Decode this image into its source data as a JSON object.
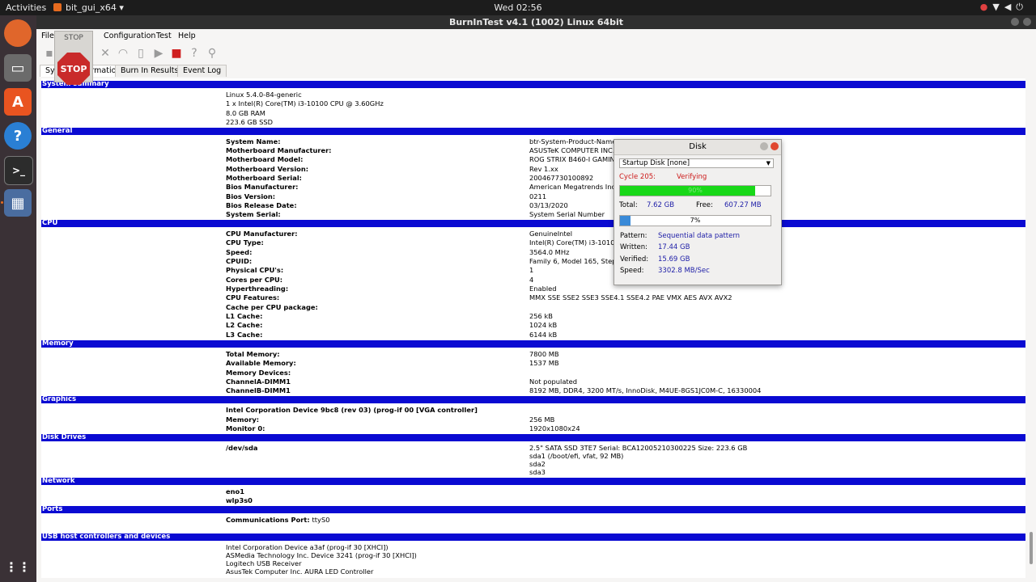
{
  "topbar": {
    "activities": "Activities",
    "app_name": "bit_gui_x64 ▾",
    "clock": "Wed 02:56",
    "tray_icons": [
      "camera-icon",
      "network-icon",
      "volume-icon",
      "power-icon"
    ]
  },
  "dock": {
    "items": [
      "firefox-icon",
      "files-icon",
      "software-icon",
      "help-icon",
      "terminal-icon",
      "burnintest-icon",
      "apps-grid-icon"
    ]
  },
  "window": {
    "title": "BurnInTest v4.1 (1002) Linux 64bit",
    "menu": [
      "File",
      "Configuration",
      "Test",
      "Help"
    ],
    "tabs": [
      "System Information",
      "Burn In Results",
      "Event Log"
    ],
    "stop_label": "STOP",
    "stop_sign": "STOP"
  },
  "sections": {
    "system_summary": {
      "title": "System summary",
      "lines": [
        "Linux 5.4.0-84-generic",
        "1 x Intel(R) Core(TM) i3-10100 CPU @ 3.60GHz",
        "8.0 GB RAM",
        "223.6 GB SSD"
      ]
    },
    "general": {
      "title": "General",
      "rows": [
        {
          "label": "System Name:",
          "value": "btr-System-Product-Name"
        },
        {
          "label": "Motherboard Manufacturer:",
          "value": "ASUSTeK COMPUTER INC."
        },
        {
          "label": "Motherboard Model:",
          "value": "ROG STRIX B460-I GAMING"
        },
        {
          "label": "Motherboard Version:",
          "value": "Rev 1.xx"
        },
        {
          "label": "Motherboard Serial:",
          "value": "200467730100892"
        },
        {
          "label": "Bios Manufacturer:",
          "value": "American Megatrends Inc."
        },
        {
          "label": "Bios Version:",
          "value": "0211"
        },
        {
          "label": "Bios Release Date:",
          "value": "03/13/2020"
        },
        {
          "label": "System Serial:",
          "value": "System Serial Number"
        }
      ]
    },
    "cpu": {
      "title": "CPU",
      "rows": [
        {
          "label": "CPU Manufacturer:",
          "value": "GenuineIntel"
        },
        {
          "label": "CPU Type:",
          "value": "Intel(R) Core(TM) i3-10100"
        },
        {
          "label": "Speed:",
          "value": "3564.0 MHz"
        },
        {
          "label": "CPUID:",
          "value": "Family 6, Model 165, Step"
        },
        {
          "label": "Physical CPU's:",
          "value": "1"
        },
        {
          "label": "Cores per CPU:",
          "value": "4"
        },
        {
          "label": "Hyperthreading:",
          "value": "Enabled"
        },
        {
          "label": "CPU Features:",
          "value": "MMX SSE SSE2 SSE3 SSE4.1 SSE4.2 PAE VMX AES AVX AVX2"
        },
        {
          "label": "Cache per CPU package:",
          "value": ""
        },
        {
          "label": "L1 Cache:",
          "value": "256 kB"
        },
        {
          "label": "L2 Cache:",
          "value": "1024 kB"
        },
        {
          "label": "L3 Cache:",
          "value": "6144 kB"
        }
      ]
    },
    "memory": {
      "title": "Memory",
      "rows": [
        {
          "label": "Total Memory:",
          "value": "7800 MB"
        },
        {
          "label": "Available Memory:",
          "value": "1537 MB"
        },
        {
          "label": "Memory Devices:",
          "value": ""
        },
        {
          "label": "ChannelA-DIMM1",
          "value": "Not populated"
        },
        {
          "label": "ChannelB-DIMM1",
          "value": "8192 MB, DDR4, 3200 MT/s, InnoDisk, M4UE-8GS1JC0M-C, 16330004"
        }
      ]
    },
    "graphics": {
      "title": "Graphics",
      "device": "Intel Corporation Device 9bc8 (rev 03) (prog-if 00 [VGA controller]",
      "rows": [
        {
          "label": "Memory:",
          "value": "256 MB"
        },
        {
          "label": "Monitor 0:",
          "value": "1920x1080x24"
        }
      ]
    },
    "disk_drives": {
      "title": "Disk Drives",
      "label": "/dev/sda",
      "values": [
        "2.5\" SATA SSD 3TE7 Serial: BCA12005210300225 Size: 223.6 GB",
        "sda1 (/boot/efi, vfat, 92 MB)",
        "sda2",
        "sda3"
      ]
    },
    "network": {
      "title": "Network",
      "items": [
        "eno1",
        "wlp3s0"
      ]
    },
    "ports": {
      "title": "Ports",
      "label": "Communications Port:",
      "value": "ttyS0"
    },
    "usb": {
      "title": "USB host controllers and devices",
      "lines": [
        "Intel Corporation Device a3af (prog-if 30 [XHCI])",
        "ASMedia Technology Inc. Device 3241 (prog-if 30 [XHCI])",
        "Logitech USB Receiver",
        "AsusTek Computer Inc. AURA LED Controller"
      ]
    }
  },
  "disk_dialog": {
    "title": "Disk",
    "selected_disk": "Startup Disk [none]",
    "cycle_label": "Cycle 205:",
    "cycle_status": "Verifying",
    "cycle_progress": 0.9,
    "cycle_progress_text": "90%",
    "total_label": "Total:",
    "total_value": "7.62 GB",
    "free_label": "Free:",
    "free_value": "607.27 MB",
    "overall_progress": 0.07,
    "overall_progress_text": "7%",
    "pattern_label": "Pattern:",
    "pattern_value": "Sequential data pattern",
    "written_label": "Written:",
    "written_value": "17.44 GB",
    "verified_label": "Verified:",
    "verified_value": "15.69 GB",
    "speed_label": "Speed:",
    "speed_value": "3302.8 MB/Sec",
    "colors": {
      "cycle_bar": "#18d818",
      "overall_bar": "#3a8ad8"
    }
  }
}
